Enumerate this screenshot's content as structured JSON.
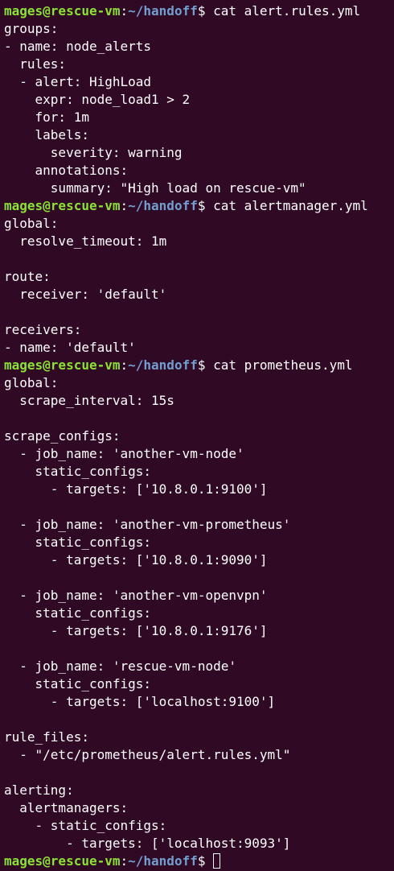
{
  "prompt": {
    "user_host": "mages@rescue-vm",
    "colon": ":",
    "path": "~/handoff",
    "dollar": "$ "
  },
  "blocks": [
    {
      "command": "cat alert.rules.yml",
      "output": [
        "groups:",
        "- name: node_alerts",
        "  rules:",
        "  - alert: HighLoad",
        "    expr: node_load1 > 2",
        "    for: 1m",
        "    labels:",
        "      severity: warning",
        "    annotations:",
        "      summary: \"High load on rescue-vm\""
      ]
    },
    {
      "command": "cat alertmanager.yml",
      "output": [
        "global:",
        "  resolve_timeout: 1m",
        "",
        "route:",
        "  receiver: 'default'",
        "",
        "receivers:",
        "- name: 'default'"
      ]
    },
    {
      "command": "cat prometheus.yml",
      "output": [
        "global:",
        "  scrape_interval: 15s",
        "",
        "scrape_configs:",
        "  - job_name: 'another-vm-node'",
        "    static_configs:",
        "      - targets: ['10.8.0.1:9100']",
        "",
        "  - job_name: 'another-vm-prometheus'",
        "    static_configs:",
        "      - targets: ['10.8.0.1:9090']",
        "",
        "  - job_name: 'another-vm-openvpn'",
        "    static_configs:",
        "      - targets: ['10.8.0.1:9176']",
        "",
        "  - job_name: 'rescue-vm-node'",
        "    static_configs:",
        "      - targets: ['localhost:9100']",
        "",
        "rule_files:",
        "  - \"/etc/prometheus/alert.rules.yml\"",
        "",
        "alerting:",
        "  alertmanagers:",
        "    - static_configs:",
        "        - targets: ['localhost:9093']"
      ]
    }
  ],
  "colors": {
    "background": "#300a24",
    "prompt_user": "#8ae234",
    "prompt_path": "#729fcf",
    "text": "#ffffff"
  },
  "icons": {
    "cursor": "block-cursor-icon"
  }
}
